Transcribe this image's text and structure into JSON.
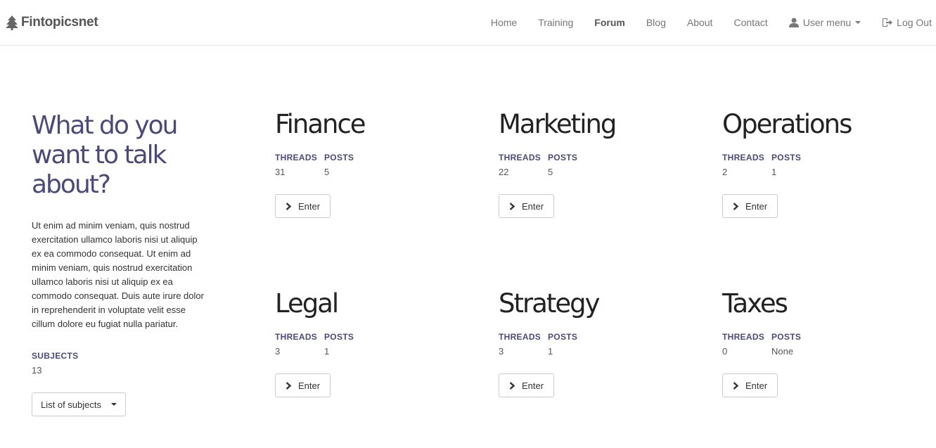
{
  "brand": {
    "name": "Fintopicsnet",
    "icon": "tree-icon"
  },
  "nav": {
    "home": "Home",
    "training": "Training",
    "forum": "Forum",
    "blog": "Blog",
    "about": "About",
    "contact": "Contact",
    "user_menu": "User menu",
    "logout": "Log Out"
  },
  "intro": {
    "heading": "What do you want to talk about?",
    "body": "Ut enim ad minim veniam, quis nostrud exercitation ullamco laboris nisi ut aliquip ex ea commodo consequat. Ut enim ad minim veniam, quis nostrud exercitation ullamco laboris nisi ut aliquip ex ea commodo consequat. Duis aute irure dolor in reprehenderit in voluptate velit esse cillum dolore eu fugiat nulla pariatur.",
    "subjects_label": "SUBJECTS",
    "subjects_count": "13",
    "dropdown_label": "List of subjects"
  },
  "labels": {
    "threads": "THREADS",
    "posts": "POSTS",
    "enter": "Enter"
  },
  "categories": [
    {
      "name": "Finance",
      "threads": "31",
      "posts": "5"
    },
    {
      "name": "Marketing",
      "threads": "22",
      "posts": "5"
    },
    {
      "name": "Operations",
      "threads": "2",
      "posts": "1"
    },
    {
      "name": "Legal",
      "threads": "3",
      "posts": "1"
    },
    {
      "name": "Strategy",
      "threads": "3",
      "posts": "1"
    },
    {
      "name": "Taxes",
      "threads": "0",
      "posts": "None"
    }
  ]
}
